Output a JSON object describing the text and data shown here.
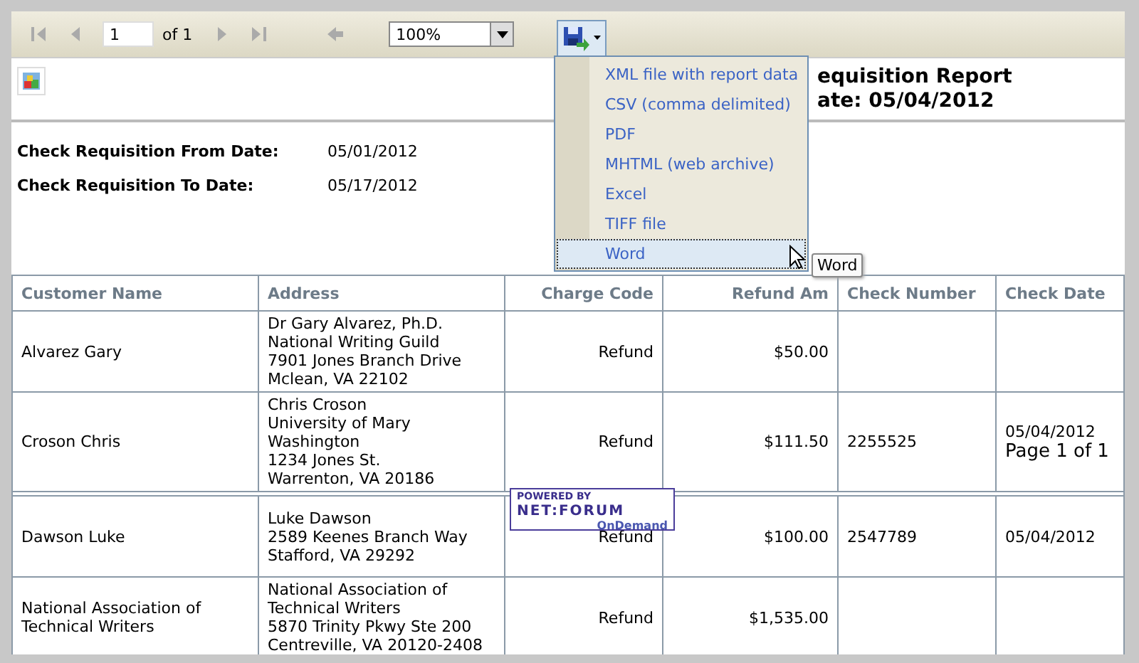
{
  "toolbar": {
    "nav_left": [
      {
        "kind": "first",
        "disabled": true
      },
      {
        "kind": "prev",
        "disabled": true
      }
    ],
    "page_input": "1",
    "page_count": "of 1",
    "nav_right": [
      {
        "kind": "next",
        "disabled": true
      },
      {
        "kind": "last",
        "disabled": true
      }
    ],
    "back": {
      "disabled": true
    },
    "zoom": "100%"
  },
  "export_menu": {
    "items": [
      {
        "label": "XML file with report data",
        "selected": false
      },
      {
        "label": "CSV (comma delimited)",
        "selected": false
      },
      {
        "label": "PDF",
        "selected": false
      },
      {
        "label": "MHTML (web archive)",
        "selected": false
      },
      {
        "label": "Excel",
        "selected": false
      },
      {
        "label": "TIFF file",
        "selected": false
      },
      {
        "label": "Word",
        "selected": true
      }
    ],
    "tooltip": "Word"
  },
  "report": {
    "title_lines": [
      "equisition Report",
      "ate: 05/04/2012"
    ],
    "params": [
      {
        "label": "Check Requisition From Date:",
        "value": "05/01/2012"
      },
      {
        "label": "Check Requisition To Date:",
        "value": "05/17/2012"
      }
    ],
    "table": {
      "columns": [
        "Customer Name",
        "Address",
        "Charge Code",
        "Refund Am",
        "Check Number",
        "Check Date"
      ],
      "rows": [
        {
          "cells": [
            "Alvarez Gary",
            "Dr Gary Alvarez, Ph.D.\nNational Writing Guild\n7901 Jones Branch Drive\nMclean, VA 22102",
            "Refund",
            "$50.00",
            "",
            ""
          ]
        },
        {
          "cells": [
            "Croson Chris",
            "Chris Croson\nUniversity of Mary\nWashington\n1234 Jones St.\nWarrenton, VA 20186",
            "Refund",
            "$111.50",
            "2255525",
            "05/04/2012"
          ],
          "page_footer": "Page 1 of 1"
        },
        {
          "cells": [
            "Dawson Luke",
            "Luke Dawson\n2589 Keenes Branch Way\nStafford, VA 29292",
            "Refund",
            "$100.00",
            "2547789",
            "05/04/2012"
          ]
        },
        {
          "cells": [
            "National Association of\nTechnical Writers",
            "National Association of\nTechnical Writers\n5870 Trinity Pkwy Ste 200\nCentreville, VA 20120-2408",
            "Refund",
            "$1,535.00",
            "",
            ""
          ]
        }
      ]
    },
    "badge": {
      "top": "POWERED BY",
      "main": "NET:FORUM",
      "sub": "OnDemand"
    }
  }
}
